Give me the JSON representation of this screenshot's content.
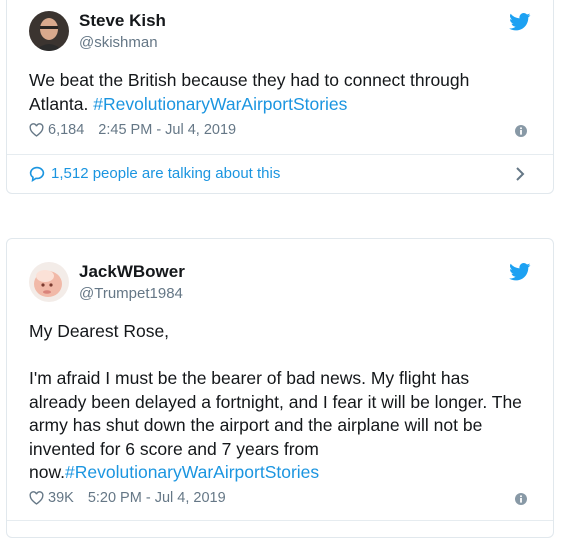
{
  "tweets": [
    {
      "author": {
        "name": "Steve Kish",
        "handle": "@skishman"
      },
      "text": "We beat the British because they had to connect through Atlanta.",
      "hashtag": "#RevolutionaryWarAirportStories",
      "likes": "6,184",
      "time": "2:45 PM - Jul 4, 2019",
      "conversation": "1,512 people are talking about this"
    },
    {
      "author": {
        "name": "JackWBower",
        "handle": "@Trumpet1984"
      },
      "salutation": "My Dearest Rose,",
      "text": "I'm afraid I must be the bearer of bad news. My flight has already been delayed a fortnight, and I fear it will be longer. The army has shut down the airport and the airplane will not be invented for 6 score and 7 years from now.",
      "hashtag": "#RevolutionaryWarAirportStories",
      "likes": "39K",
      "time": "5:20 PM - Jul 4, 2019"
    }
  ],
  "icons": {
    "bird": "twitter-bird-icon",
    "like": "heart-icon",
    "info": "info-icon",
    "reply": "speech-bubble-icon",
    "chevron": "chevron-right-icon"
  },
  "colors": {
    "brand": "#1da1f2",
    "link": "#1b95e0",
    "muted": "#657786",
    "text": "#14171a",
    "border": "#e1e8ed"
  }
}
